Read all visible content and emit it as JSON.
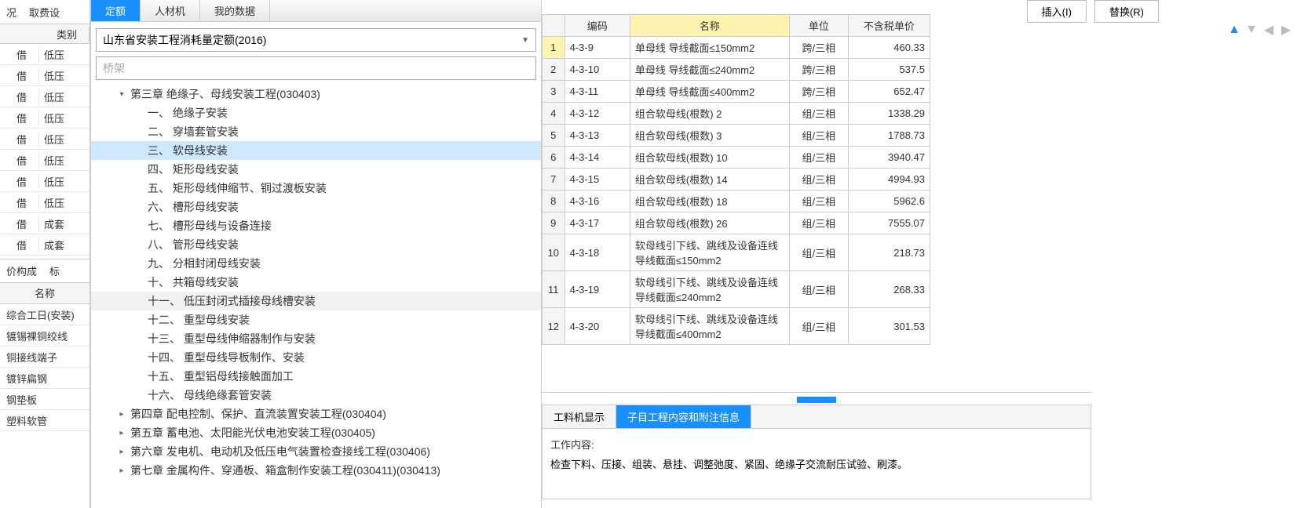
{
  "buttons": {
    "insert": "插入(I)",
    "replace": "替换(R)"
  },
  "leftTop": {
    "tab1": "况",
    "tab2": "取费设"
  },
  "leftHeader": {
    "col1": "",
    "col2": "类别"
  },
  "leftRows": [
    {
      "c1": "借",
      "c2": "低压"
    },
    {
      "c1": "借",
      "c2": "低压"
    },
    {
      "c1": "借",
      "c2": "低压"
    },
    {
      "c1": "借",
      "c2": "低压"
    },
    {
      "c1": "借",
      "c2": "低压"
    },
    {
      "c1": "借",
      "c2": "低压"
    },
    {
      "c1": "借",
      "c2": "低压"
    },
    {
      "c1": "借",
      "c2": "低压"
    },
    {
      "c1": "借",
      "c2": "成套"
    },
    {
      "c1": "借",
      "c2": "成套"
    }
  ],
  "leftBottom": {
    "tab1": "价构成",
    "tab2": "标"
  },
  "leftSubheader": "名称",
  "materials": [
    "综合工日(安装)",
    "镀锡裸铜绞线",
    "铜接线端子",
    "镀锌扁钢",
    "钢垫板",
    "塑料软管"
  ],
  "treeTabs": [
    "定额",
    "人材机",
    "我的数据"
  ],
  "dropdown": "山东省安装工程消耗量定额(2016)",
  "searchPlaceholder": "桥架",
  "treeRoot": "第三章 绝缘子、母线安装工程(030403)",
  "treeItems": [
    "一、 绝缘子安装",
    "二、 穿墙套管安装",
    "三、 软母线安装",
    "四、 矩形母线安装",
    "五、 矩形母线伸缩节、铜过渡板安装",
    "六、 槽形母线安装",
    "七、 槽形母线与设备连接",
    "八、 管形母线安装",
    "九、 分相封闭母线安装",
    "十、 共箱母线安装",
    "十一、 低压封闭式插接母线槽安装",
    "十二、 重型母线安装",
    "十三、 重型母线伸缩器制作与安装",
    "十四、 重型母线导板制作、安装",
    "十五、 重型铝母线接触面加工",
    "十六、 母线绝缘套管安装"
  ],
  "chapters": [
    "第四章 配电控制、保护、直流装置安装工程(030404)",
    "第五章 蓄电池、太阳能光伏电池安装工程(030405)",
    "第六章 发电机、电动机及低压电气装置检查接线工程(030406)",
    "第七章 金属构件、穿通板、箱盒制作安装工程(030411)(030413)"
  ],
  "tableHeader": {
    "code": "编码",
    "name": "名称",
    "unit": "单位",
    "price": "不含税单价"
  },
  "tableRows": [
    {
      "n": "1",
      "code": "4-3-9",
      "name": "单母线 导线截面≤150mm2",
      "unit": "跨/三相",
      "price": "460.33"
    },
    {
      "n": "2",
      "code": "4-3-10",
      "name": "单母线 导线截面≤240mm2",
      "unit": "跨/三相",
      "price": "537.5"
    },
    {
      "n": "3",
      "code": "4-3-11",
      "name": "单母线 导线截面≤400mm2",
      "unit": "跨/三相",
      "price": "652.47"
    },
    {
      "n": "4",
      "code": "4-3-12",
      "name": "组合软母线(根数) 2",
      "unit": "组/三相",
      "price": "1338.29"
    },
    {
      "n": "5",
      "code": "4-3-13",
      "name": "组合软母线(根数) 3",
      "unit": "组/三相",
      "price": "1788.73"
    },
    {
      "n": "6",
      "code": "4-3-14",
      "name": "组合软母线(根数) 10",
      "unit": "组/三相",
      "price": "3940.47"
    },
    {
      "n": "7",
      "code": "4-3-15",
      "name": "组合软母线(根数) 14",
      "unit": "组/三相",
      "price": "4994.93"
    },
    {
      "n": "8",
      "code": "4-3-16",
      "name": "组合软母线(根数) 18",
      "unit": "组/三相",
      "price": "5962.6"
    },
    {
      "n": "9",
      "code": "4-3-17",
      "name": "组合软母线(根数) 26",
      "unit": "组/三相",
      "price": "7555.07"
    },
    {
      "n": "10",
      "code": "4-3-18",
      "name": "软母线引下线、跳线及设备连线 导线截面≤150mm2",
      "unit": "组/三相",
      "price": "218.73"
    },
    {
      "n": "11",
      "code": "4-3-19",
      "name": "软母线引下线、跳线及设备连线 导线截面≤240mm2",
      "unit": "组/三相",
      "price": "268.33"
    },
    {
      "n": "12",
      "code": "4-3-20",
      "name": "软母线引下线、跳线及设备连线 导线截面≤400mm2",
      "unit": "组/三相",
      "price": "301.53"
    }
  ],
  "bottomTabs": [
    "工料机显示",
    "子目工程内容和附注信息"
  ],
  "workLabel": "工作内容:",
  "workContent": "检查下料、压接、组装、悬挂、调整弛度、紧固、绝缘子交流耐压试验、刷漆。"
}
